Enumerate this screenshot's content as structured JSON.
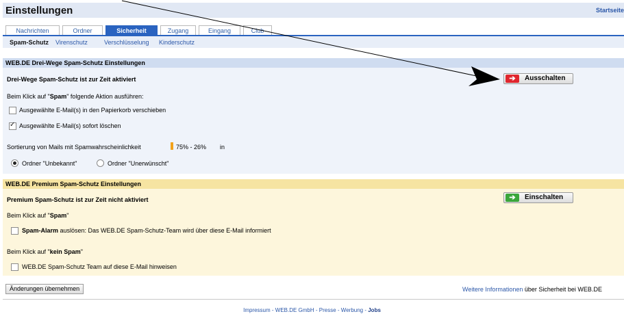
{
  "header": {
    "title": "Einstellungen",
    "start_link": "Startseite"
  },
  "tabs": [
    {
      "label": "Nachrichten"
    },
    {
      "label": "Ordner"
    },
    {
      "label": "Sicherheit"
    },
    {
      "label": "Zugang"
    },
    {
      "label": "Eingang"
    },
    {
      "label": "Club"
    }
  ],
  "subtabs": [
    {
      "label": "Spam-Schutz"
    },
    {
      "label": "Virenschutz"
    },
    {
      "label": "Verschlüsselung"
    },
    {
      "label": "Kinderschutz"
    }
  ],
  "section1": {
    "title": "WEB.DE Drei-Wege Spam-Schutz Einstellungen",
    "status": "Drei-Wege Spam-Schutz ist zur Zeit aktiviert",
    "button_label": "Ausschalten",
    "click_pre": "Beim Klick auf \"",
    "click_word": "Spam",
    "click_post": "\" folgende Aktion ausführen:",
    "option1": "Ausgewählte E-Mail(s) in den Papierkorb verschieben",
    "option2": "Ausgewählte E-Mail(s) sofort löschen",
    "sort_label": "Sortierung von Mails mit Spamwahrscheinlichkeit",
    "sort_range": "75% - 26%",
    "sort_in": "in",
    "radio1": "Ordner \"Unbekannt\"",
    "radio2": "Ordner \"Unerwünscht\""
  },
  "section2": {
    "title": "WEB.DE Premium Spam-Schutz Einstellungen",
    "status": "Premium Spam-Schutz ist zur Zeit nicht aktiviert",
    "button_label": "Einschalten",
    "click1_pre": "Beim Klick auf \"",
    "click1_word": "Spam",
    "click1_post": "\"",
    "alarm_bold": "Spam-Alarm",
    "alarm_rest": " auslösen: Das WEB.DE Spam-Schutz-Team wird über diese E-Mail informiert",
    "click2_pre": "Beim Klick auf \"",
    "click2_word": "kein Spam",
    "click2_post": "\"",
    "hint": "WEB.DE Spam-Schutz Team auf diese E-Mail hinweisen"
  },
  "apply_button": "Änderungen übernehmen",
  "more_info": {
    "link": "Weitere Informationen",
    "rest": " über Sicherheit bei WEB.DE"
  },
  "footer": {
    "impressum": "Impressum",
    "company": "WEB.DE GmbH",
    "presse": "Presse",
    "werbung": "Werbung",
    "jobs": "Jobs",
    "separator": " - "
  },
  "colors": {
    "accent": "#2a63c0",
    "off_button": "#e0262e",
    "on_button": "#3aa63a"
  }
}
